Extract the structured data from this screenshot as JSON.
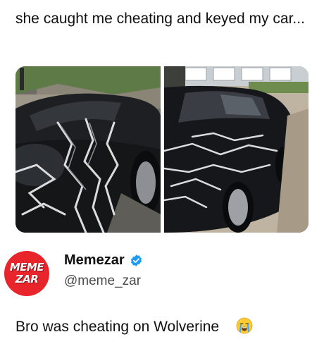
{
  "post": {
    "caption": "she caught me cheating and keyed my car...",
    "images": [
      {
        "icon": "keyed-car-front-photo"
      },
      {
        "icon": "keyed-car-side-photo"
      }
    ]
  },
  "author": {
    "avatar_text_line1": "MEME",
    "avatar_text_line2": "ZAR",
    "name": "Memezar",
    "handle": "@meme_zar",
    "verified_icon": "verified-badge-icon",
    "avatar_color": "#e8252b",
    "verified_color": "#1d9bf0"
  },
  "tweet": {
    "text": "Bro was cheating on Wolverine",
    "emoji": "loudly-crying-face-icon"
  }
}
